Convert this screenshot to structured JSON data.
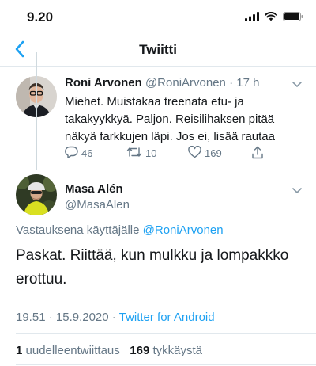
{
  "status_bar": {
    "time": "9.20"
  },
  "nav": {
    "title": "Twiitti"
  },
  "parent_tweet": {
    "author_name": "Roni Arvonen",
    "author_handle": "@RoniArvonen",
    "separator": "·",
    "age": "17 h",
    "text": "Miehet. Muistakaa treenata etu- ja takakyykkyä. Paljon. Reisilihaksen pitää näkyä farkkujen läpi. Jos ei, lisää rautaa",
    "replies": "46",
    "retweets": "10",
    "likes": "169"
  },
  "main_tweet": {
    "author_name": "Masa Alén",
    "author_handle": "@MasaAlen",
    "reply_prefix": "Vastauksena käyttäjälle",
    "reply_to": "@RoniArvonen",
    "text": "Paskat. Riittää, kun mulkku ja lompakkko erottuu.",
    "time": "19.51",
    "date": "15.9.2020",
    "dot": "·",
    "source": "Twitter for Android",
    "retweet_count": "1",
    "retweet_label": "uudelleentwiittaus",
    "like_count": "169",
    "like_label": "tykkäystä"
  },
  "icons": {
    "back": "chevron-left-icon",
    "more": "chevron-down-icon",
    "reply": "comment-icon",
    "retweet": "retweet-icon",
    "like": "heart-icon",
    "share": "share-icon",
    "signal": "cellular-signal-icon",
    "wifi": "wifi-icon",
    "battery": "battery-icon"
  },
  "colors": {
    "accent": "#1da1f2",
    "text_primary": "#14171a",
    "text_secondary": "#657786",
    "divider": "#e1e8ed"
  }
}
